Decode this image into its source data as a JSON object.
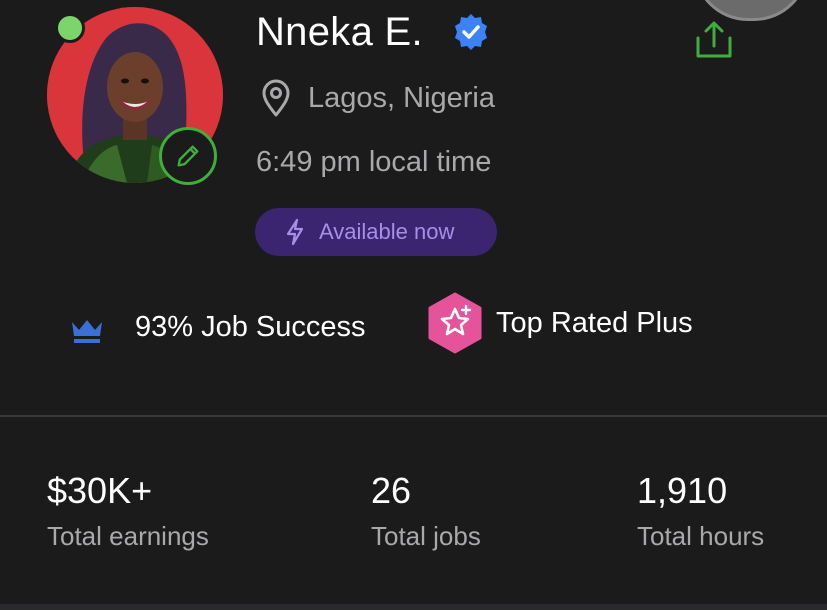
{
  "profile": {
    "name": "Nneka E.",
    "location": "Lagos, Nigeria",
    "local_time": "6:49 pm local time",
    "availability": "Available now"
  },
  "badges": {
    "job_success": "93% Job Success",
    "top_rated": "Top Rated Plus"
  },
  "stats": [
    {
      "value": "$30K+",
      "label": "Total earnings"
    },
    {
      "value": "26",
      "label": "Total jobs"
    },
    {
      "value": "1,910",
      "label": "Total hours"
    }
  ],
  "colors": {
    "background": "#1b1b1c",
    "online": "#7bd56b",
    "edit_ring": "#3fae3a",
    "verified": "#3b82f6",
    "available_bg": "#3b2470",
    "available_text": "#a88ee6",
    "crown": "#3b6fd6",
    "top_rated": "#e5549a",
    "muted_text": "#a9a9ab"
  },
  "icons": {
    "verified": "verified-check-icon",
    "share": "share-icon",
    "location": "location-pin-icon",
    "bolt": "lightning-bolt-icon",
    "crown": "crown-icon",
    "top_rated": "top-rated-star-icon",
    "edit": "pencil-icon"
  }
}
